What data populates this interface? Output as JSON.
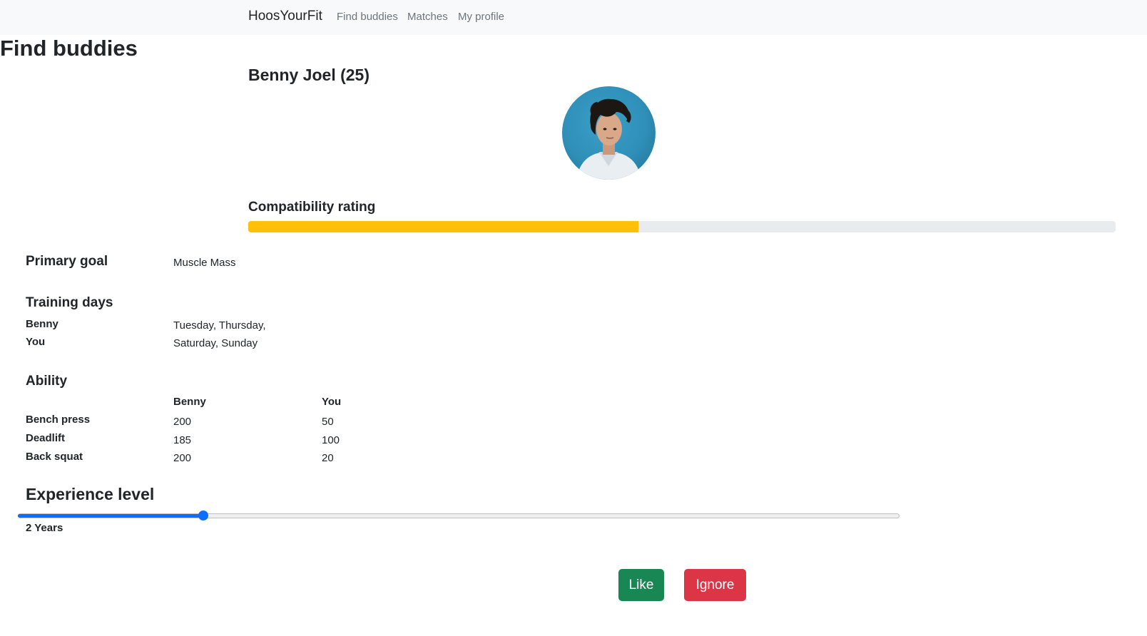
{
  "navbar": {
    "brand": "HoosYourFit",
    "links": [
      "Find buddies",
      "Matches",
      "My profile"
    ]
  },
  "page_title": "Find buddies",
  "profile": {
    "name_age": "Benny Joel (25)",
    "avatar_icon": "person-photo-icon"
  },
  "compatibility": {
    "label": "Compatibility rating",
    "fraction": 0.45,
    "color": "#ffc107"
  },
  "primary_goal": {
    "heading": "Primary goal",
    "value": "Muscle Mass"
  },
  "training_days": {
    "heading": "Training days",
    "rows": [
      {
        "label": "Benny",
        "value": "Tuesday, Thursday,"
      },
      {
        "label": "You",
        "value": "Saturday, Sunday"
      }
    ]
  },
  "ability": {
    "heading": "Ability",
    "columns": [
      "Benny",
      "You"
    ],
    "rows": [
      {
        "label": "Bench press",
        "benny": "200",
        "you": "50"
      },
      {
        "label": "Deadlift",
        "benny": "185",
        "you": "100"
      },
      {
        "label": "Back squat",
        "benny": "200",
        "you": "20"
      }
    ]
  },
  "experience": {
    "heading": "Experience level",
    "value_label": "2 Years",
    "fraction": 0.21,
    "color": "#0d6efd"
  },
  "actions": {
    "like_label": "Like",
    "ignore_label": "Ignore",
    "like_color": "#198754",
    "ignore_color": "#dc3545"
  }
}
